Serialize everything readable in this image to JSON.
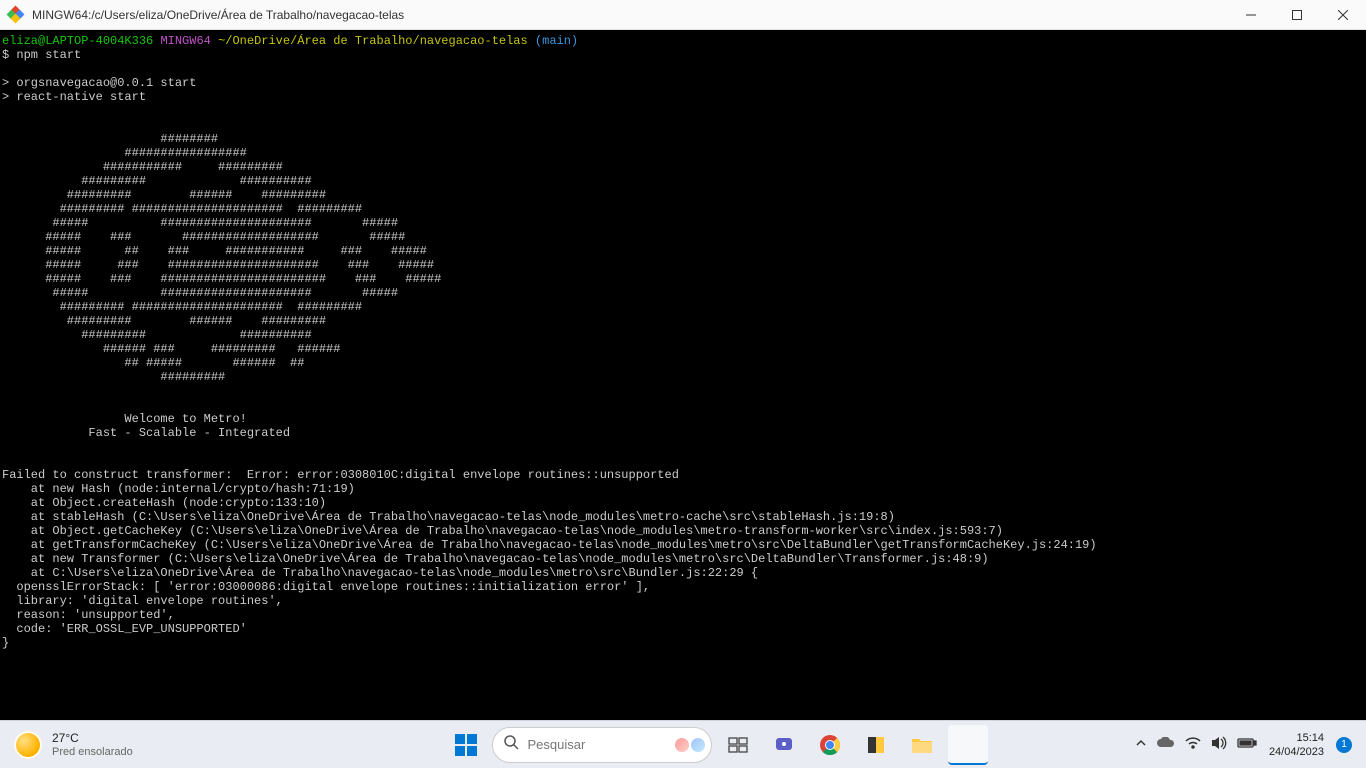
{
  "window": {
    "title": "MINGW64:/c/Users/eliza/OneDrive/Área de Trabalho/navegacao-telas"
  },
  "prompt": {
    "user_host": "eliza@LAPTOP-4004K336",
    "shell": "MINGW64",
    "cwd": "~/OneDrive/Área de Trabalho/navegacao-telas",
    "branch": "(main)",
    "symbol": "$",
    "command": "npm start"
  },
  "script_lines": [
    "> orgsnavegacao@0.0.1 start",
    "> react-native start"
  ],
  "ascii_art": "                      ########                                                                                                  \n                 #################                                                                                              \n              ###########     #########                                                                                         \n           #########             ##########                                                                                     \n         #########        ######    #########                                                                                   \n        ######### #####################  #########                                                                              \n       #####          #####################       #####                                                                         \n      #####    ###       ###################       #####                                                                        \n      #####      ##    ###     ###########     ###    #####                                                                     \n      #####     ###    #####################    ###    #####                                                                    \n      #####    ###    #######################    ###    #####                                                                   \n       #####          #####################       #####                                                                         \n        ######### #####################  #########                                                                              \n         #########        ######    #########                                                                                   \n           #########             ##########                                                                                     \n              ###### ###     #########   ######                                                                                 \n                 ## #####       ######  ##                                                                                      \n                      #########                                                                                                 ",
  "welcome": {
    "line1": "                 Welcome to Metro!",
    "line2": "            Fast - Scalable - Integrated"
  },
  "error_lines": [
    "Failed to construct transformer:  Error: error:0308010C:digital envelope routines::unsupported",
    "    at new Hash (node:internal/crypto/hash:71:19)",
    "    at Object.createHash (node:crypto:133:10)",
    "    at stableHash (C:\\Users\\eliza\\OneDrive\\Área de Trabalho\\navegacao-telas\\node_modules\\metro-cache\\src\\stableHash.js:19:8)",
    "    at Object.getCacheKey (C:\\Users\\eliza\\OneDrive\\Área de Trabalho\\navegacao-telas\\node_modules\\metro-transform-worker\\src\\index.js:593:7)",
    "    at getTransformCacheKey (C:\\Users\\eliza\\OneDrive\\Área de Trabalho\\navegacao-telas\\node_modules\\metro\\src\\DeltaBundler\\getTransformCacheKey.js:24:19)",
    "    at new Transformer (C:\\Users\\eliza\\OneDrive\\Área de Trabalho\\navegacao-telas\\node_modules\\metro\\src\\DeltaBundler\\Transformer.js:48:9)",
    "    at C:\\Users\\eliza\\OneDrive\\Área de Trabalho\\navegacao-telas\\node_modules\\metro\\src\\Bundler.js:22:29 {",
    "  opensslErrorStack: [ 'error:03000086:digital envelope routines::initialization error' ],",
    "  library: 'digital envelope routines',",
    "  reason: 'unsupported',",
    "  code: 'ERR_OSSL_EVP_UNSUPPORTED'",
    "}"
  ],
  "taskbar": {
    "weather": {
      "temp": "27°C",
      "condition": "Pred ensolarado"
    },
    "search_placeholder": "Pesquisar",
    "clock": {
      "time": "15:14",
      "date": "24/04/2023"
    },
    "notif_count": "1"
  }
}
